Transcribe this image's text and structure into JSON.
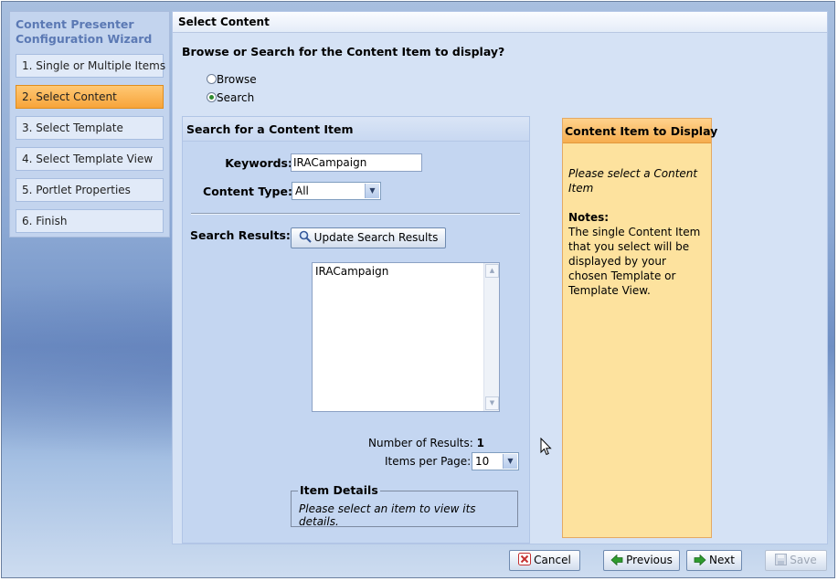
{
  "wizard": {
    "title": "Content Presenter Configuration Wizard",
    "steps": [
      {
        "label": "1. Single or Multiple Items",
        "active": false
      },
      {
        "label": "2. Select Content",
        "active": true
      },
      {
        "label": "3. Select Template",
        "active": false
      },
      {
        "label": "4. Select Template View",
        "active": false
      },
      {
        "label": "5. Portlet Properties",
        "active": false
      },
      {
        "label": "6. Finish",
        "active": false
      }
    ]
  },
  "main": {
    "header": "Select Content",
    "question": "Browse or Search for the Content Item to display?",
    "options": [
      {
        "label": "Browse",
        "selected": false
      },
      {
        "label": "Search",
        "selected": true
      }
    ]
  },
  "search": {
    "title": "Search for a Content Item",
    "keywords_label": "Keywords:",
    "keywords_value": "IRACampaign",
    "content_type_label": "Content Type:",
    "content_type_value": "All",
    "results_label": "Search Results:",
    "update_button": "Update Search Results",
    "results": [
      "IRACampaign"
    ],
    "num_results_label": "Number of Results:",
    "num_results_value": "1",
    "items_per_page_label": "Items per Page:",
    "items_per_page_value": "10",
    "item_details_title": "Item Details",
    "item_details_msg": "Please select an item to view its details."
  },
  "display": {
    "title": "Content Item to Display",
    "placeholder": "Please select a Content Item",
    "notes_title": "Notes:",
    "notes_text": "The single Content Item that you select will be displayed by your chosen Template or Template View."
  },
  "footer": {
    "cancel": "Cancel",
    "previous": "Previous",
    "next": "Next",
    "save": "Save"
  },
  "colors": {
    "active_step": "#f7a43a",
    "display_panel": "#fde29e",
    "main_panel": "#d5e2f5"
  }
}
